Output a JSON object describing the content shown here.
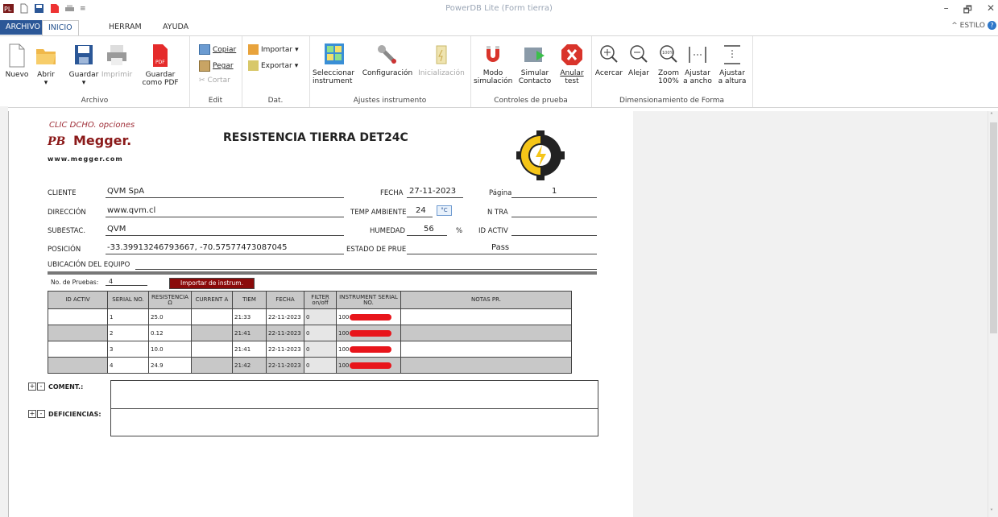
{
  "titlebar": {
    "title": "PowerDB Lite (Form tierra)"
  },
  "tabs": [
    {
      "label": "ARCHIVO"
    },
    {
      "label": "INICIO"
    },
    {
      "label": "HERRAM"
    },
    {
      "label": "AYUDA"
    }
  ],
  "style_menu": "^ ESTILO",
  "ribbon": {
    "archivo": {
      "nuevo": "Nuevo",
      "abrir": "Abrir",
      "guardar": "Guardar",
      "imprimir": "Imprimir",
      "guardar_pdf_1": "Guardar",
      "guardar_pdf_2": "como PDF",
      "label": "Archivo"
    },
    "edit": {
      "copiar": "Copiar",
      "pegar": "Pegar",
      "cortar": "Cortar",
      "label": "Edit"
    },
    "dat": {
      "importar": "Importar",
      "exportar": "Exportar",
      "label": "Dat."
    },
    "ajustes": {
      "sel_1": "Seleccionar",
      "sel_2": "instrument",
      "config": "Configuración",
      "init": "Inicialización",
      "label": "Ajustes instrumento"
    },
    "controles": {
      "modo_1": "Modo",
      "modo_2": "simulación",
      "sim_1": "Simular",
      "sim_2": "Contacto",
      "anular_1": "Anular",
      "anular_2": "test",
      "label": "Controles de prueba"
    },
    "dim": {
      "acercar": "Acercar",
      "alejar": "Alejar",
      "zoom_1": "Zoom",
      "zoom_2": "100%",
      "ancho_1": "Ajustar",
      "ancho_2": "a ancho",
      "altura_1": "Ajustar",
      "altura_2": "a altura",
      "label": "Dimensionamiento de Forma"
    }
  },
  "form": {
    "hint": "CLIC DCHO. opciones",
    "brand": "Megger.",
    "website": "www.megger.com",
    "title": "RESISTENCIA TIERRA DET24C",
    "cliente_lbl": "CLIENTE",
    "cliente": "QVM SpA",
    "direccion_lbl": "DIRECCIÓN",
    "direccion": "www.qvm.cl",
    "subestac_lbl": "SUBESTAC.",
    "subestac": "QVM",
    "posicion_lbl": "POSICIÓN",
    "posicion": "-33.39913246793667, -70.57577473087045",
    "ubicacion_lbl": "UBICACIÓN DEL EQUIPO",
    "fecha_lbl": "FECHA",
    "fecha": "27-11-2023",
    "temp_lbl": "TEMP AMBIENTE",
    "temp": "24",
    "temp_unit": "°C",
    "humedad_lbl": "HUMEDAD",
    "humedad": "56",
    "humedad_unit": "%",
    "estado_lbl": "ESTADO DE PRUE",
    "estado": "Pass",
    "pagina_lbl": "Página",
    "pagina": "1",
    "ntra_lbl": "N TRA",
    "idactiv_lbl": "ID ACTIV",
    "num_pruebas_lbl": "No. de Pruebas:",
    "num_pruebas": "4",
    "importar_btn": "Importar de instrum.",
    "coment_lbl": "COMENT.:",
    "deficiencias_lbl": "DEFICIENCIAS:"
  },
  "table": {
    "headers": [
      "ID ACTIV",
      "SERIAL NO.",
      "RESISTENCIA Ω",
      "CURRENT A",
      "TIEM",
      "FECHA",
      "FILTER on/off",
      "INSTRUMENT SERIAL NO.",
      "NOTAS PR."
    ],
    "rows": [
      {
        "id": "",
        "serial": "1",
        "res": "25.0",
        "cur": "",
        "tiem": "21:33",
        "fecha": "22-11-2023",
        "filter": "0",
        "inst": "100"
      },
      {
        "id": "",
        "serial": "2",
        "res": "0.12",
        "cur": "",
        "tiem": "21:41",
        "fecha": "22-11-2023",
        "filter": "0",
        "inst": "100"
      },
      {
        "id": "",
        "serial": "3",
        "res": "10.0",
        "cur": "",
        "tiem": "21:41",
        "fecha": "22-11-2023",
        "filter": "0",
        "inst": "100"
      },
      {
        "id": "",
        "serial": "4",
        "res": "24.9",
        "cur": "",
        "tiem": "21:42",
        "fecha": "22-11-2023",
        "filter": "0",
        "inst": "100"
      }
    ]
  },
  "colors": {
    "accent": "#2b5797",
    "import_button": "#8b0a0a",
    "redaction": "#e8151b",
    "logo": "#f5c518"
  }
}
